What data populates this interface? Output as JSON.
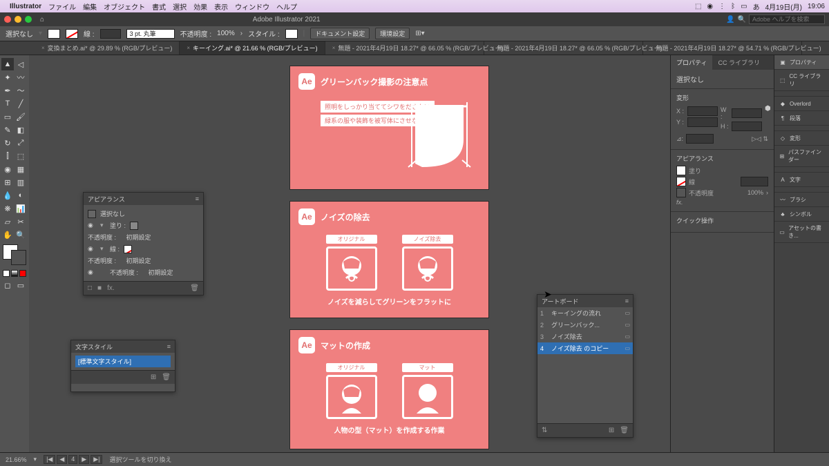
{
  "mac_menu": {
    "app": "Illustrator",
    "items": [
      "ファイル",
      "編集",
      "オブジェクト",
      "書式",
      "選択",
      "効果",
      "表示",
      "ウィンドウ",
      "ヘルプ"
    ],
    "right": {
      "date": "4月19日(月)",
      "time": "19:06"
    }
  },
  "window": {
    "title": "Adobe Illustrator 2021",
    "search_placeholder": "Adobe ヘルプを検索"
  },
  "controlbar": {
    "selection": "選択なし",
    "stroke_label": "線 :",
    "stroke_weight": "3 pt. 丸筆",
    "opacity_label": "不透明度 :",
    "opacity": "100%",
    "style_label": "スタイル :",
    "doc_setup": "ドキュメント設定",
    "prefs": "環境設定"
  },
  "tabs": [
    {
      "label": "変換まとめ.ai* @ 29.89 % (RGB/プレビュー)",
      "active": false
    },
    {
      "label": "キーイング.ai* @ 21.66 % (RGB/プレビュー)",
      "active": true
    },
    {
      "label": "無題 - 2021年4月19日 18.27* @ 66.05 % (RGB/プレビュー)",
      "active": false
    },
    {
      "label": "無題 - 2021年4月19日 18.27* @ 66.05 % (RGB/プレビュー)",
      "active": false
    },
    {
      "label": "無題 - 2021年4月19日 18.27* @ 54.71 % (RGB/プレビュー)",
      "active": false
    }
  ],
  "artboards_content": {
    "1": {
      "title": "グリーンバック撮影の注意点",
      "bullets": [
        "照明をしっかり当ててシワをださない",
        "緑系の服や装飾を被写体にさせない"
      ]
    },
    "2": {
      "title": "ノイズの除去",
      "thumbs": [
        "オリジナル",
        "ノイズ除去"
      ],
      "caption": "ノイズを減らしてグリーンをフラットに"
    },
    "3": {
      "title": "マットの作成",
      "thumbs": [
        "オリジナル",
        "マット"
      ],
      "caption": "人物の型（マット）を作成する作業"
    }
  },
  "appearance_panel": {
    "title": "アピアランス",
    "none": "選択なし",
    "fill": "塗り :",
    "opacity": "不透明度 :",
    "opacity_default": "初期設定",
    "stroke": "線 :"
  },
  "textstyle_panel": {
    "title": "文字スタイル",
    "item": "[標準文字スタイル]"
  },
  "artboards_panel": {
    "title": "アートボード",
    "rows": [
      {
        "n": "1",
        "name": "キーイングの流れ"
      },
      {
        "n": "2",
        "name": "グリーンバック..."
      },
      {
        "n": "3",
        "name": "ノイズ除去"
      },
      {
        "n": "4",
        "name": "ノイズ除去 のコピー"
      }
    ]
  },
  "properties": {
    "tab1": "プロパティ",
    "tab2": "CC ライブラリ",
    "sel_none": "選択なし",
    "transform": "変形",
    "x": "X :",
    "y": "Y :",
    "w": "W :",
    "h": "H :",
    "appearance": "アピアランス",
    "fill": "塗り",
    "stroke": "線",
    "opacity_lbl": "不透明度",
    "opacity_val": "100%",
    "quick": "クイック操作"
  },
  "right_strip": [
    {
      "icon": "▣",
      "label": "プロパティ"
    },
    {
      "icon": "⬚",
      "label": "CC ライブラリ"
    },
    {
      "icon": "◆",
      "label": "Overlord"
    },
    {
      "icon": "¶",
      "label": "段落"
    },
    {
      "icon": "◇",
      "label": "変形"
    },
    {
      "icon": "⊞",
      "label": "パスファインダー"
    },
    {
      "icon": "A",
      "label": "文字"
    },
    {
      "icon": "〰",
      "label": "ブラシ"
    },
    {
      "icon": "♣",
      "label": "シンボル"
    },
    {
      "icon": "▭",
      "label": "アセットの書き..."
    }
  ],
  "statusbar": {
    "zoom": "21.66%",
    "artboard": "4",
    "hint": "選択ツールを切り換え"
  }
}
